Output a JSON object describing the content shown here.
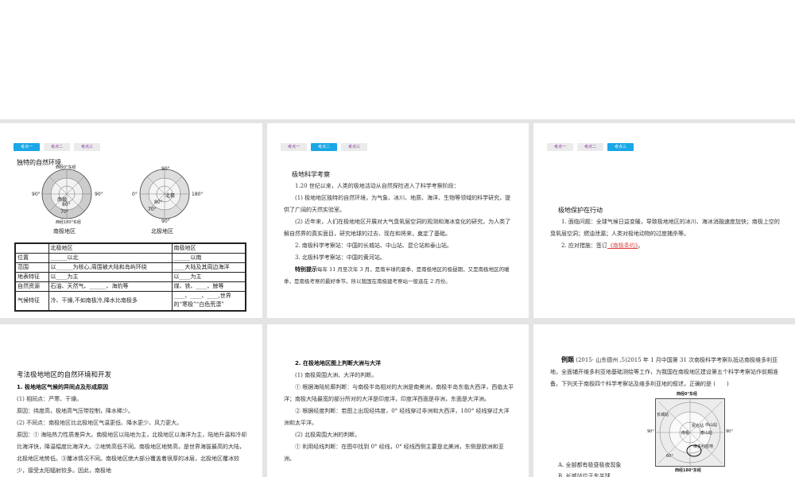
{
  "tabs": [
    "考点一",
    "考点二",
    "考点三"
  ],
  "slide1": {
    "title": "独特的自然环境",
    "south_map": {
      "top": "西经0°东经",
      "left": "90°",
      "right": "90°",
      "bottom": "西经180°东经",
      "pole": "南极",
      "lat1": "80°",
      "lat2": "70°",
      "caption": "南极地区"
    },
    "north_map": {
      "top": "90°",
      "left": "0°",
      "right": "180°",
      "bottom": "90°",
      "pole": "北极",
      "lat1": "80°",
      "lat2": "70°",
      "caption": "北极地区"
    },
    "table": {
      "headers": [
        "",
        "北极地区",
        "南极地区"
      ],
      "rows": [
        [
          "位置",
          "______以北",
          "______以南"
        ],
        [
          "范围",
          "以______为核心,周围被大陆和岛屿环绕",
          "____大陆及其周边海洋"
        ],
        [
          "地表特征",
          "以____为主",
          "以____为主"
        ],
        [
          "自然资源",
          "石油、天然气、______、海豹等",
          "煤、铁、____、鲸等"
        ],
        [
          "气候特征",
          "冷、干燥,不如南极冷,降水比南极多",
          "____、____、____,世界的“寒极”“白色荒漠”"
        ]
      ]
    }
  },
  "slide2": {
    "title": "极地科学考察",
    "p1": "1.20 世纪以来，人类的极地活动从自然探险进入了科学考察阶段：",
    "p2": "(1) 极地地区独特的自然环境，为气象、冰川、地质、海洋、生物等领域的科学研究，提供了广阔的天然实验室。",
    "p3": "(2) 近年来，人们在极地地区开展对大气臭氧层空洞的观测和海冰变化的研究，为人类了解自然界的真实面目，研究地球的过去、现在和将来，奠定了基础。",
    "p4": "2. 南极科学考察站：中国的长城站、中山站、昆仑站和泰山站。",
    "p5": "3. 北极科学考察站：中国的黄河站。",
    "tip_label": "特别提示",
    "tip": "每年 11 月至次年 3 月，是南半球的夏季，是南极地区的极昼期，又是南极地区的暖季，是南极考察的最好季节。所以我国在南极建考察站一般选在 2 月份。"
  },
  "slide3": {
    "title": "极地保护在行动",
    "p1": "1. 面临问题：全球气候日益变暖，导致极地地区的冰川、海冰消融速度加快；南极上空的臭氧层空洞；燃油泄漏；人类对极地动物的过度捕杀等。",
    "p2": "2. 应对措施：签订",
    "p2_answer": "《南极条约》",
    "p2_end": "。"
  },
  "slide4": {
    "title": "考法极地地区的自然环境和开发",
    "sub": "1. 极地地区气候的异同点及形成原因",
    "lines": [
      "(1) 相同点：严寒、干燥。",
      "原因：纬度高，极地高气压带控制，降水稀少。",
      "(2) 不同点：南极地区比北极地区气温更低、降水更少、风力更大。",
      "原因：① 海陆热力性质差异大。南极地区以陆地为主，北极地区以海洋为主，陆地升温和冷却比海洋快，降温幅度比海洋大。②地势高低不同。南极地区地势高，是世界海拔最高的大陆，北极地区地势低。③覆冰情况不同。南极地区绝大部分覆盖着很厚的冰层，北极地区覆冰较少，接受太阳辐射较多。因此，南极地"
    ]
  },
  "slide5": {
    "sub": "2. 在极地地区图上判断大洲与大洋",
    "lines": [
      "(1) 南极周围大洲、大洋的判断。",
      "① 根据海陆轮廓判断：与南极半岛相对的大洲是南美洲，南极半岛东临大西洋，西临太平洋；南极大陆最宽的部分所对的大洋是印度洋，印度洋西面是非洲，东面是大洋洲。",
      "② 根据经度判断：若图上出现经纬度，0° 经线穿过非洲和大西洋，180° 经线穿过大洋洲和太平洋。",
      "(2) 北极周围大洲的判断。",
      "① 利用经线判断：在图中找到 0° 经线，0° 经线西侧主要是北美洲，东侧是欧洲和亚洲。"
    ]
  },
  "slide6": {
    "label": "例题",
    "question": "(2015· 山东德州 ,5)2015 年 1 月中国第 31 次南极科学考察队抵达南极维多利亚地，全面铺开维多利亚地基础测绘等工作，为我国在南极地区建设第五个科学考察站作前期准备。下列关于南极四个科学考察站及维多利亚地的叙述，正确的是 (　　)",
    "map": {
      "top": "西经0°东经",
      "bottom": "西经180°东经",
      "left": "90°",
      "right": "90°",
      "pole": "南极",
      "changcheng": "长城站",
      "kunlun": "昆仑站",
      "zhongshan": "中山站",
      "taishan": "泰山站",
      "victoria": "维多利亚地",
      "lat": "60°"
    },
    "option_a": "A. 全部都有极昼极夜现象",
    "option_b": "B. 长城站位于东半球"
  }
}
